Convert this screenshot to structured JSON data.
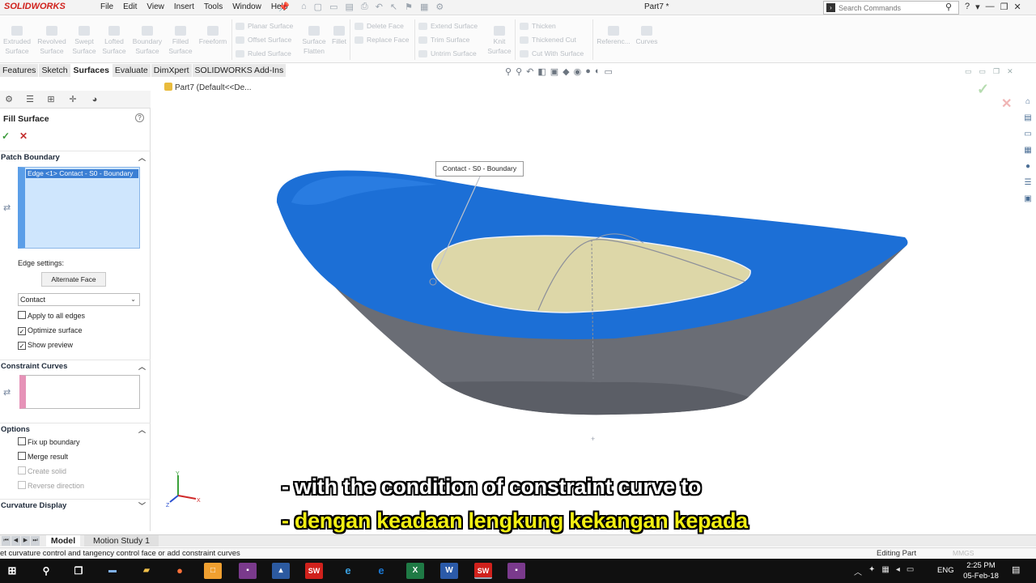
{
  "app": {
    "logo": "SOLIDWORKS",
    "doc_title": "Part7 *",
    "menus": [
      "File",
      "Edit",
      "View",
      "Insert",
      "Tools",
      "Window",
      "Help"
    ],
    "search_placeholder": "Search Commands",
    "window_controls": [
      "?",
      "▾",
      "—",
      "❐",
      "✕"
    ]
  },
  "ribbon": {
    "big_buttons": [
      {
        "label": "Extruded\nSurface"
      },
      {
        "label": "Revolved\nSurface"
      },
      {
        "label": "Swept\nSurface"
      },
      {
        "label": "Lofted\nSurface"
      },
      {
        "label": "Boundary\nSurface"
      },
      {
        "label": "Filled\nSurface"
      },
      {
        "label": "Freeform"
      }
    ],
    "small_col1": [
      "Planar Surface",
      "Offset Surface",
      "Ruled Surface"
    ],
    "surface_flatten": "Surface\nFlatten",
    "fillet": "Fillet",
    "small_col2": [
      "Delete Face",
      "Replace Face"
    ],
    "small_col3": [
      "Extend Surface",
      "Trim Surface",
      "Untrim Surface"
    ],
    "knit": "Knit\nSurface",
    "small_col4": [
      "Thicken",
      "Thickened Cut",
      "Cut With Surface"
    ],
    "reference": "Referenc...",
    "curves": "Curves"
  },
  "tabs": [
    "Features",
    "Sketch",
    "Surfaces",
    "Evaluate",
    "DimXpert",
    "SOLIDWORKS Add-Ins"
  ],
  "active_tab": "Surfaces",
  "property_manager": {
    "title": "Fill Surface",
    "patch_boundary": {
      "header": "Patch Boundary",
      "items": [
        "Edge <1> Contact - S0 - Boundary"
      ]
    },
    "edge_settings_label": "Edge settings:",
    "alternate_face_button": "Alternate Face",
    "condition_value": "Contact",
    "checkboxes1": [
      {
        "label": "Apply to all edges",
        "checked": false
      },
      {
        "label": "Optimize surface",
        "checked": true
      },
      {
        "label": "Show preview",
        "checked": true
      }
    ],
    "constraint_curves_header": "Constraint Curves",
    "options_header": "Options",
    "options": [
      {
        "label": "Fix up boundary",
        "checked": false,
        "enabled": true
      },
      {
        "label": "Merge result",
        "checked": false,
        "enabled": true
      },
      {
        "label": "Create solid",
        "checked": false,
        "enabled": false
      },
      {
        "label": "Reverse direction",
        "checked": false,
        "enabled": false
      }
    ],
    "curvature_display_header": "Curvature Display"
  },
  "graphics": {
    "breadcrumb": "Part7  (Default<<De...",
    "callout": "Contact - S0 - Boundary",
    "colors": {
      "top_surface": "#1c6fd6",
      "side_surface": "#6a6d75",
      "fill_patch": "#ddd7a8"
    }
  },
  "subtitles": {
    "english": "- with the condition of constraint curve to",
    "malay": "- dengan keadaan lengkung kekangan kepada"
  },
  "bottom_tabs": [
    "Model",
    "Motion Study 1"
  ],
  "status": {
    "message": "et curvature control and tangency control face or add constraint curves",
    "mode": "Editing Part",
    "units": "MMGS"
  },
  "taskbar": {
    "language": "ENG",
    "time": "2:25 PM",
    "date": "05-Feb-18"
  }
}
